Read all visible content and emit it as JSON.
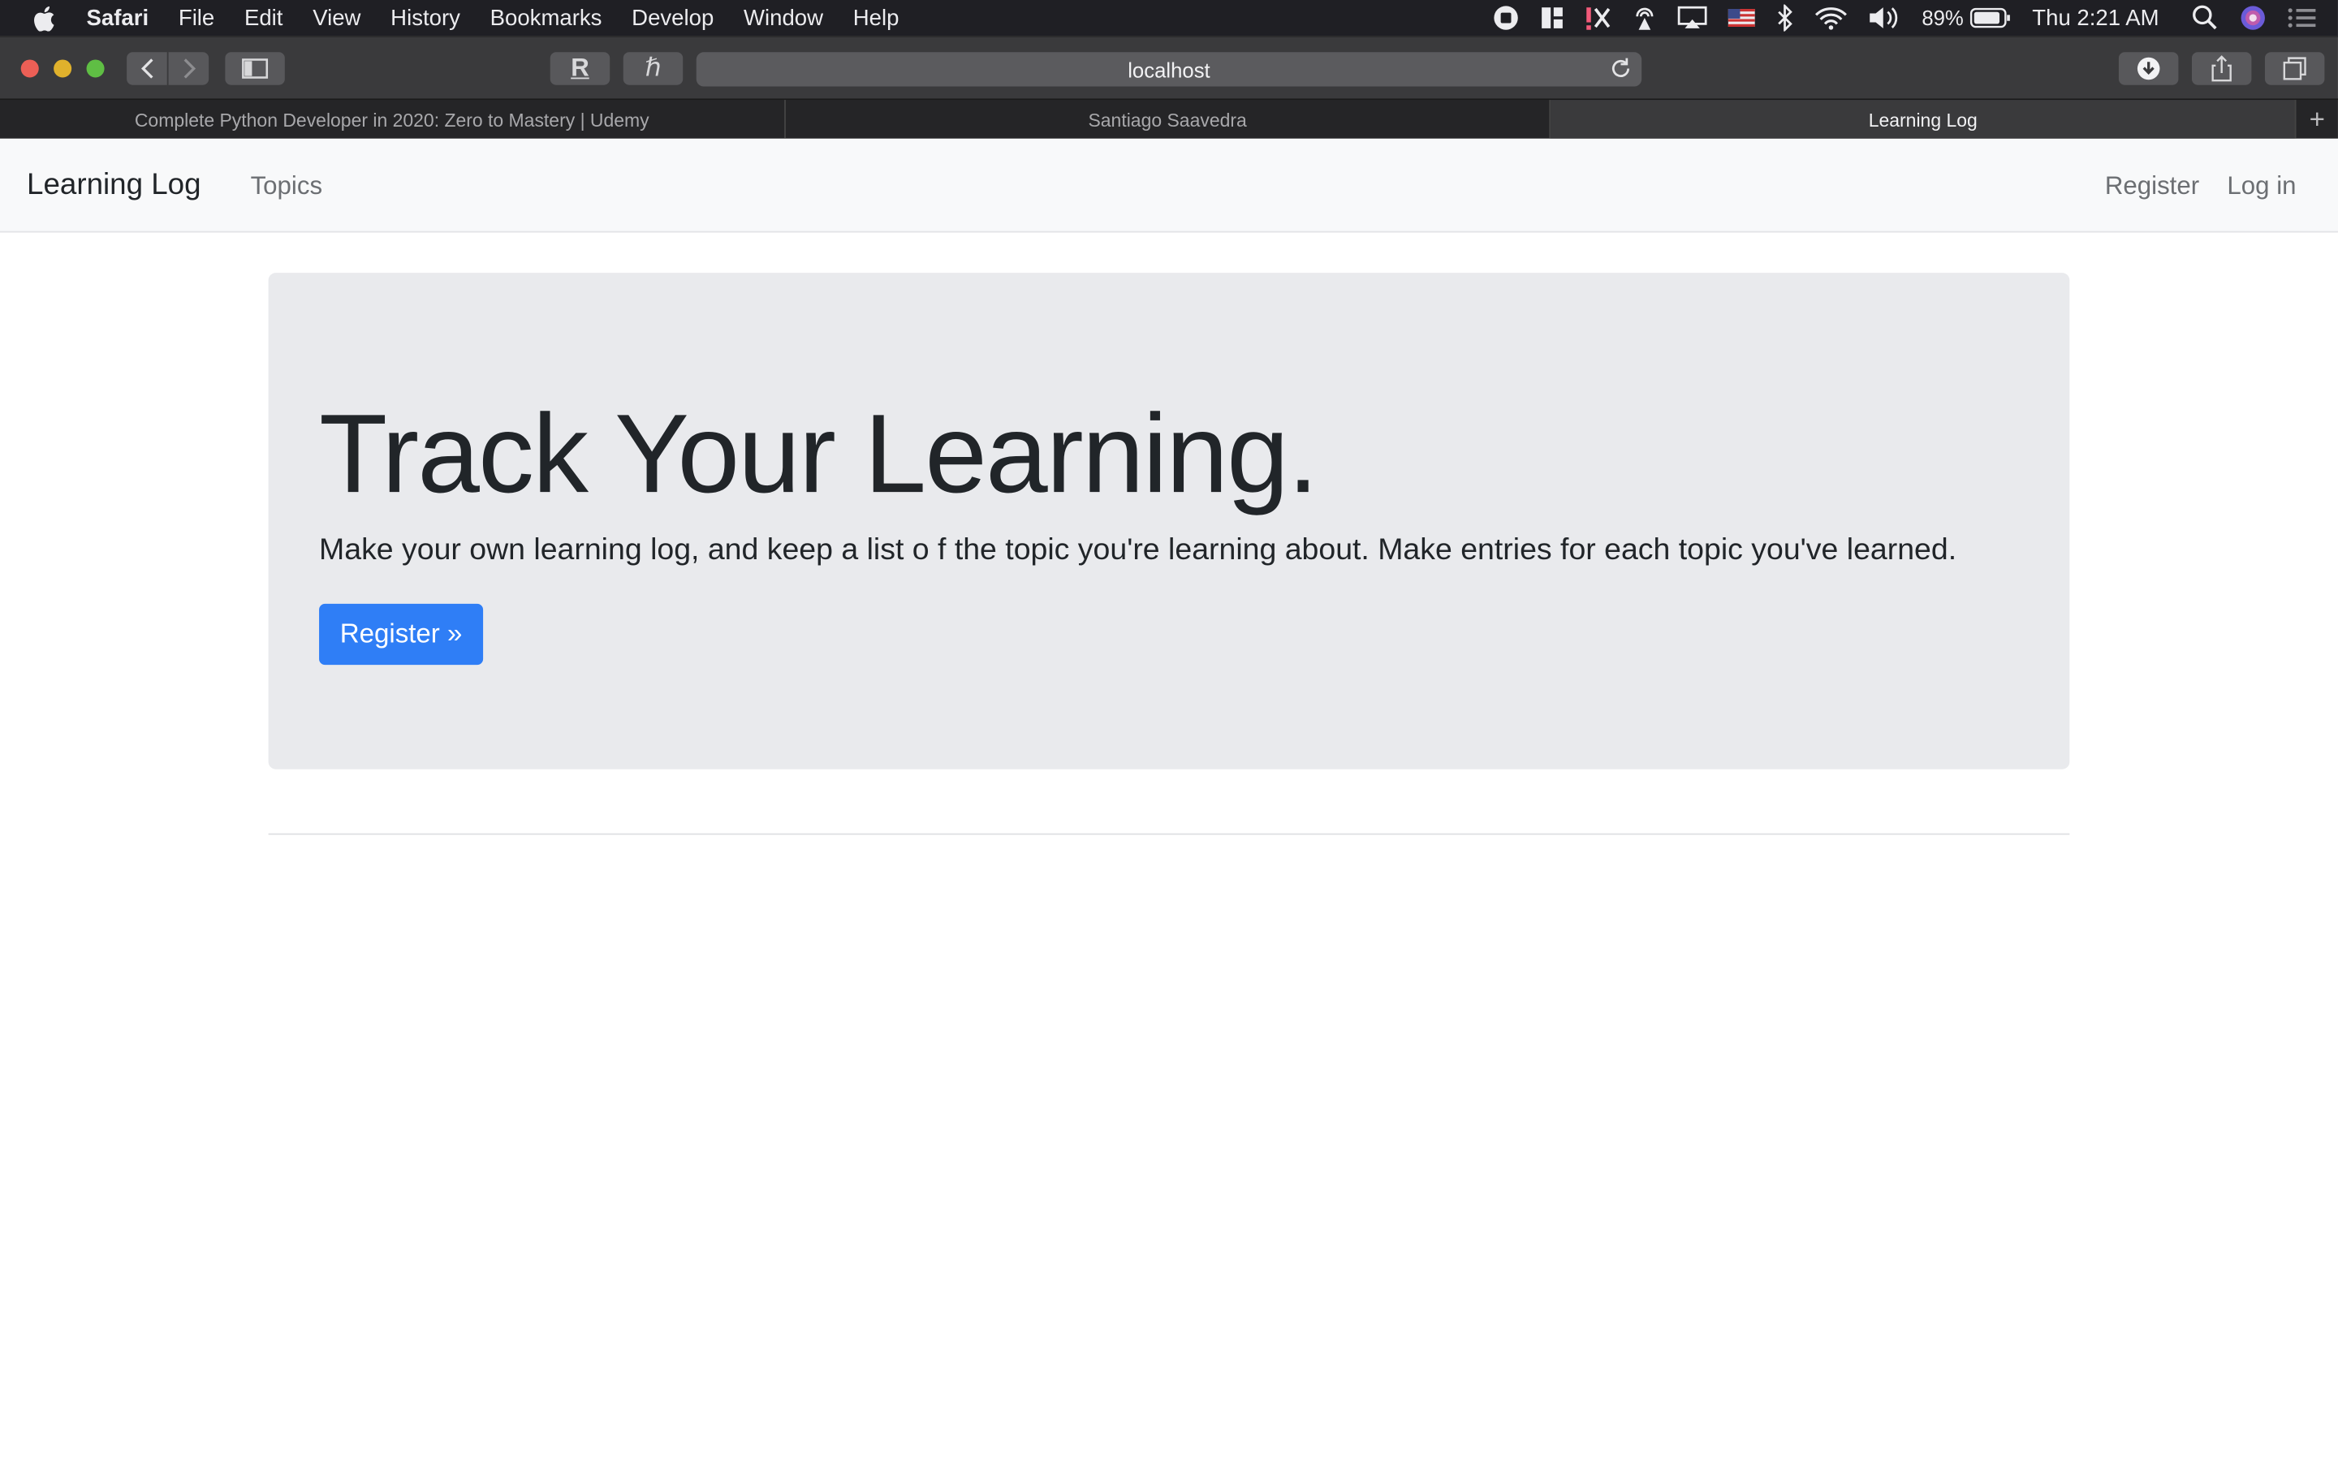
{
  "menubar": {
    "app_name": "Safari",
    "items": [
      "File",
      "Edit",
      "View",
      "History",
      "Bookmarks",
      "Develop",
      "Window",
      "Help"
    ],
    "battery": "89%",
    "clock": "Thu 2:21 AM"
  },
  "toolbar": {
    "url": "localhost",
    "ext1_label": "R",
    "ext2_label": "ℏ"
  },
  "tabs": [
    {
      "title": "Complete Python Developer in 2020: Zero to Mastery | Udemy",
      "active": false
    },
    {
      "title": "Santiago Saavedra",
      "active": false
    },
    {
      "title": "Learning Log",
      "active": true
    }
  ],
  "tab_add_label": "+",
  "navbar": {
    "brand": "Learning Log",
    "topics": "Topics",
    "register": "Register",
    "login": "Log in"
  },
  "hero": {
    "title": "Track Your Learning.",
    "lead": "Make your own learning log, and keep a list o f the topic you're learning about. Make entries for each topic you've learned.",
    "button": "Register »"
  },
  "colors": {
    "primary": "#2f7ef6",
    "jumbotron_bg": "#e9eaed",
    "navbar_bg": "#f8f9fa"
  }
}
